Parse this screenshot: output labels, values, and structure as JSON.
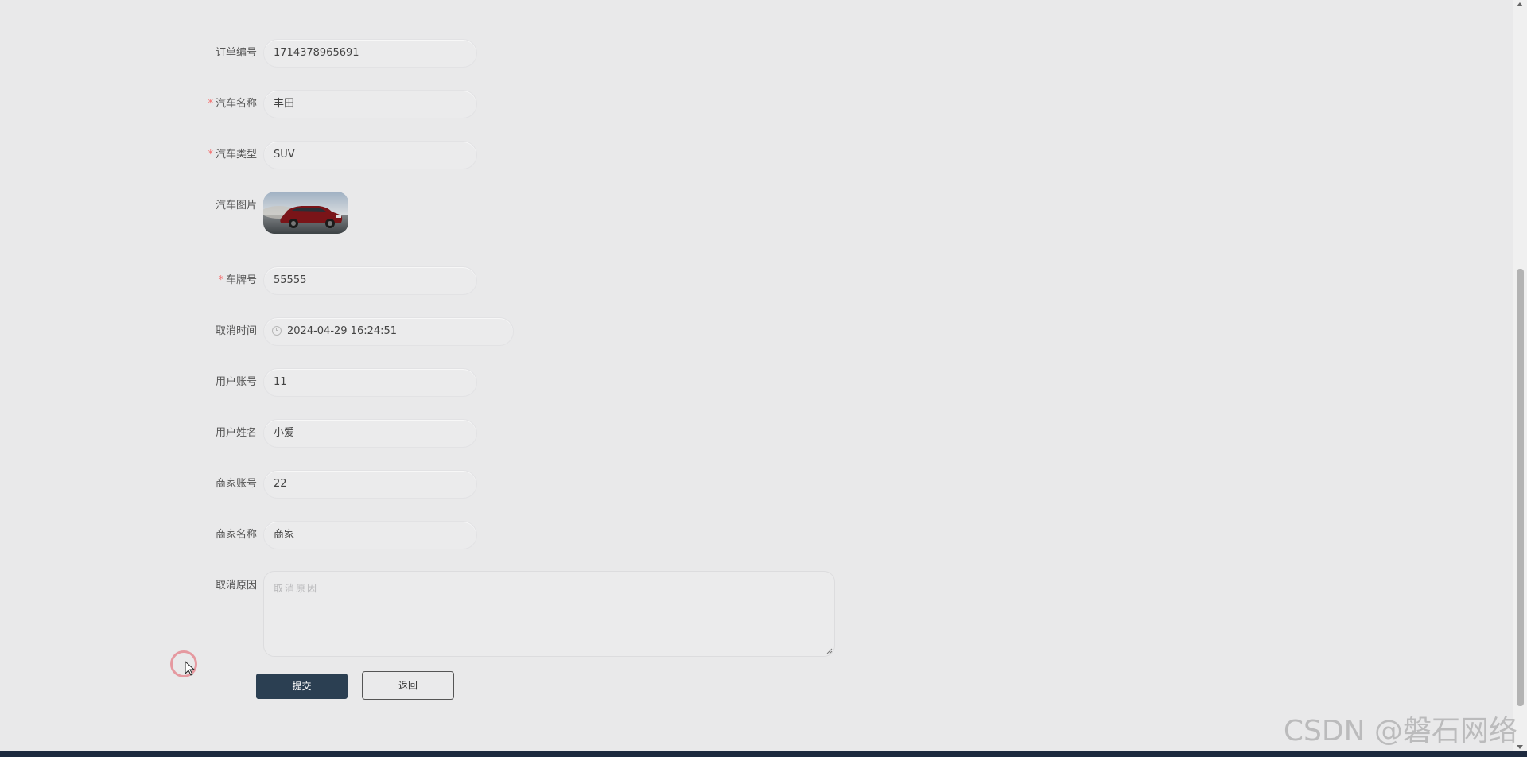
{
  "form": {
    "order_no": {
      "label": "订单编号",
      "value": "1714378965691",
      "required": false
    },
    "car_name": {
      "label": "汽车名称",
      "value": "丰田",
      "required": true
    },
    "car_type": {
      "label": "汽车类型",
      "value": "SUV",
      "required": true
    },
    "car_image": {
      "label": "汽车图片",
      "image_desc": "red-suv-photo"
    },
    "plate_no": {
      "label": "车牌号",
      "value": "55555",
      "required": true
    },
    "cancel_time": {
      "label": "取消时间",
      "value": "2024-04-29 16:24:51",
      "icon": "clock-icon"
    },
    "user_account": {
      "label": "用户账号",
      "value": "11"
    },
    "user_name": {
      "label": "用户姓名",
      "value": "小爱"
    },
    "merchant_account": {
      "label": "商家账号",
      "value": "22"
    },
    "merchant_name": {
      "label": "商家名称",
      "value": "商家"
    },
    "cancel_reason": {
      "label": "取消原因",
      "placeholder": "取消原因",
      "value": ""
    },
    "required_mark": "*"
  },
  "buttons": {
    "submit_label": "提交",
    "back_label": "返回"
  },
  "watermark": "CSDN @磐石网络",
  "colors": {
    "page_bg": "#e9e9ea",
    "submit_bg": "#2b3f52",
    "required": "#f56c6c",
    "bottom_bar": "#1d2a3f"
  }
}
